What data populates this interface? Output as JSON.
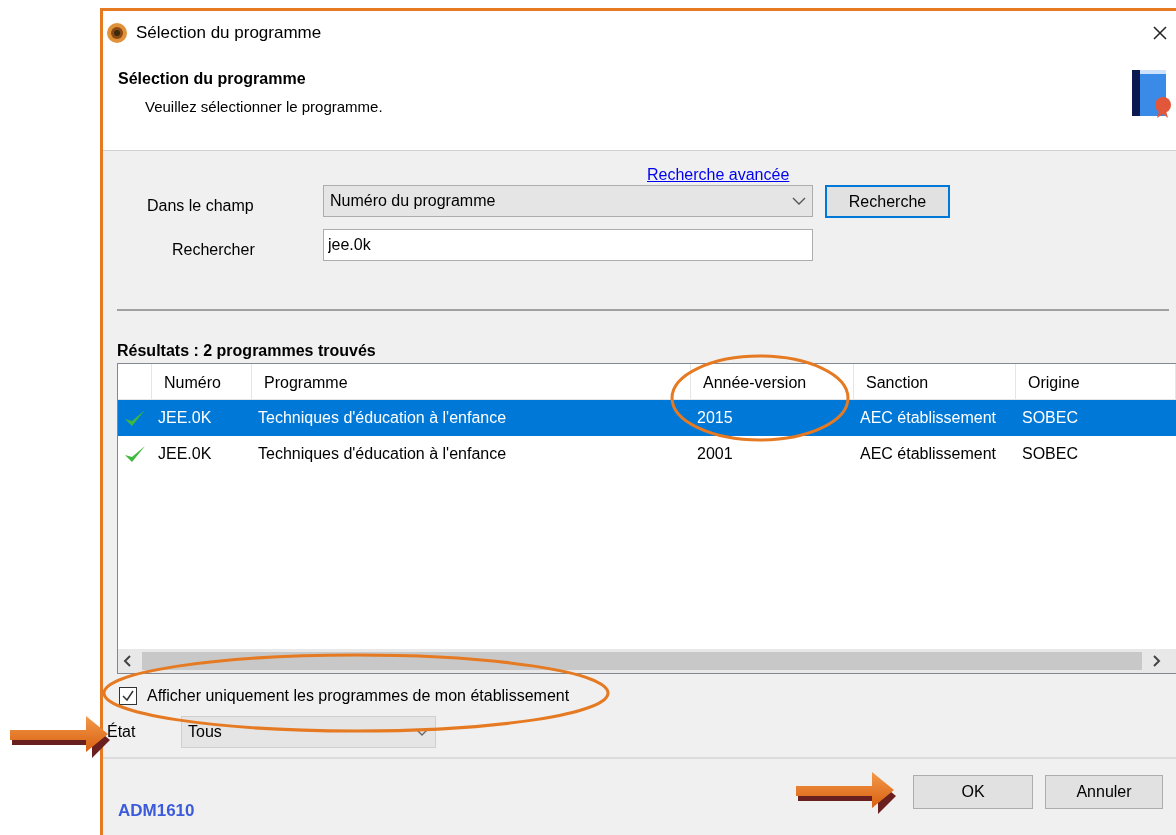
{
  "window": {
    "title": "Sélection du programme"
  },
  "header": {
    "title": "Sélection du programme",
    "subtitle": "Veuillez sélectionner le programme."
  },
  "search": {
    "advanced_link": "Recherche avancée",
    "field_label": "Dans le champ",
    "field_value": "Numéro du programme",
    "search_button": "Recherche",
    "query_label": "Rechercher",
    "query_value": "jee.0k"
  },
  "results": {
    "title": "Résultats : 2 programmes trouvés",
    "columns": [
      "Numéro",
      "Programme",
      "Année-version",
      "Sanction",
      "Origine"
    ],
    "rows": [
      {
        "selected": true,
        "cells": [
          "JEE.0K",
          "Techniques d'éducation à l'enfance",
          "2015",
          "AEC établissement",
          "SOBEC"
        ]
      },
      {
        "selected": false,
        "cells": [
          "JEE.0K",
          "Techniques d'éducation à l'enfance",
          "2001",
          "AEC établissement",
          "SOBEC"
        ]
      }
    ]
  },
  "own_only": {
    "label": "Afficher uniquement les programmes de mon établissement",
    "checked": true
  },
  "state_filter": {
    "label": "État",
    "value": "Tous"
  },
  "footer": {
    "code": "ADM1610",
    "buttons": [
      {
        "label": "OK"
      },
      {
        "label": "Annuler"
      }
    ]
  }
}
